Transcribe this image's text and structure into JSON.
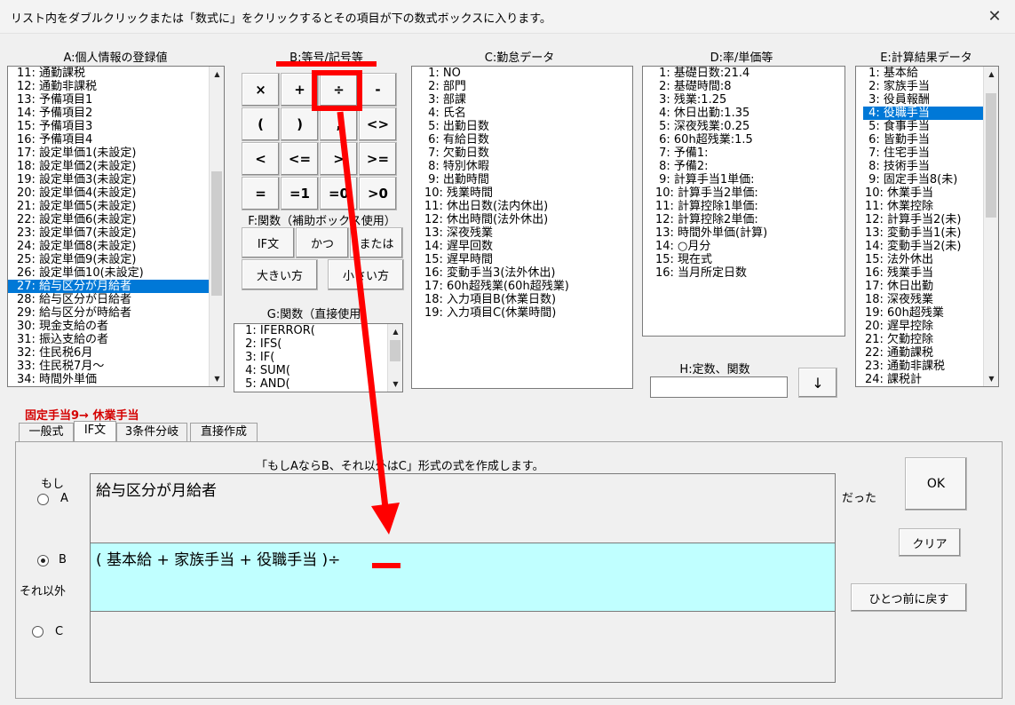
{
  "window": {
    "title": "リスト内をダブルクリックまたは「数式に」をクリックするとその項目が下の数式ボックスに入ります。",
    "close": "✕"
  },
  "groups": {
    "a": "A:個人情報の登録値",
    "b": "B:等号/記号等",
    "c": "C:勤怠データ",
    "d": "D:率/単価等",
    "e": "E:計算結果データ",
    "f": "F:関数（補助ボックス使用）",
    "g": "G:関数（直接使用）",
    "h": "H:定数、関数"
  },
  "list_a": [
    "11: 通勤課税",
    "12: 通勤非課税",
    "13: 予備項目1",
    "14: 予備項目2",
    "15: 予備項目3",
    "16: 予備項目4",
    "17: 設定単価1(未設定)",
    "18: 設定単価2(未設定)",
    "19: 設定単価3(未設定)",
    "20: 設定単価4(未設定)",
    "21: 設定単価5(未設定)",
    "22: 設定単価6(未設定)",
    "23: 設定単価7(未設定)",
    "24: 設定単価8(未設定)",
    "25: 設定単価9(未設定)",
    "26: 設定単価10(未設定)",
    "27: 給与区分が月給者",
    "28: 給与区分が日給者",
    "29: 給与区分が時給者",
    "30: 現金支給の者",
    "31: 振込支給の者",
    "32: 住民税6月",
    "33: 住民税7月～",
    "34: 時間外単価"
  ],
  "list_c": [
    " 1: NO",
    " 2: 部門",
    " 3: 部課",
    " 4: 氏名",
    " 5: 出勤日数",
    " 6: 有給日数",
    " 7: 欠勤日数",
    " 8: 特別休暇",
    " 9: 出勤時間",
    "10: 残業時間",
    "11: 休出日数(法内休出)",
    "12: 休出時間(法外休出)",
    "13: 深夜残業",
    "14: 遅早回数",
    "15: 遅早時間",
    "16: 変動手当3(法外休出)",
    "17: 60h超残業(60h超残業)",
    "18: 入力項目B(休業日数)",
    "19: 入力項目C(休業時間)"
  ],
  "list_d": [
    " 1: 基礎日数:21.4",
    " 2: 基礎時間:8",
    " 3: 残業:1.25",
    " 4: 休日出勤:1.35",
    " 5: 深夜残業:0.25",
    " 6: 60h超残業:1.5",
    " 7: 予備1:",
    " 8: 予備2:",
    " 9: 計算手当1単価:",
    "10: 計算手当2単価:",
    "11: 計算控除1単価:",
    "12: 計算控除2単価:",
    "13: 時間外単価(計算)",
    "14: ○月分",
    "15: 現在式",
    "16: 当月所定日数"
  ],
  "list_e": [
    " 1: 基本給",
    " 2: 家族手当",
    " 3: 役員報酬",
    " 4: 役職手当",
    " 5: 食事手当",
    " 6: 皆勤手当",
    " 7: 住宅手当",
    " 8: 技術手当",
    " 9: 固定手当8(未)",
    "10: 休業手当",
    "11: 休業控除",
    "12: 計算手当2(未)",
    "13: 変動手当1(未)",
    "14: 変動手当2(未)",
    "15: 法外休出",
    "16: 残業手当",
    "17: 休日出勤",
    "18: 深夜残業",
    "19: 60h超残業",
    "20: 遅早控除",
    "21: 欠勤控除",
    "22: 通勤課税",
    "23: 通勤非課税",
    "24: 課税計"
  ],
  "list_g": [
    " 1: IFERROR(",
    " 2: IFS(",
    " 3: IF(",
    " 4: SUM(",
    " 5: AND("
  ],
  "symbols": [
    "×",
    "+",
    "÷",
    "-",
    "(",
    ")",
    ",",
    "<>",
    "<",
    "<=",
    ">",
    ">=",
    "=",
    "=1",
    "=0",
    ">0"
  ],
  "functions": [
    "IF文",
    "かつ",
    "または",
    "大きい方",
    "小さい方"
  ],
  "h_input": "",
  "down_arrow": "↓",
  "status_label": "固定手当9→ 休業手当",
  "tabs": [
    "一般式",
    "IF文",
    "3条件分岐",
    "直接作成"
  ],
  "if_panel": {
    "description": "「もしAならB、それ以外はC」形式の式を作成します。",
    "moshi": "もし",
    "a": "A",
    "b": "B",
    "sore_igai": "それ以外",
    "c": "C",
    "datta": "だった",
    "box_a": "給与区分が月給者",
    "box_b": "( 基本給 + 家族手当 + 役職手当 )÷",
    "box_c": ""
  },
  "buttons": {
    "ok": "OK",
    "clear": "クリア",
    "undo": "ひとつ前に戻す"
  },
  "colors": {
    "selection": "#0078d7",
    "highlight": "#ff0000",
    "formula_bg": "#c0ffff",
    "status": "#d40000"
  }
}
